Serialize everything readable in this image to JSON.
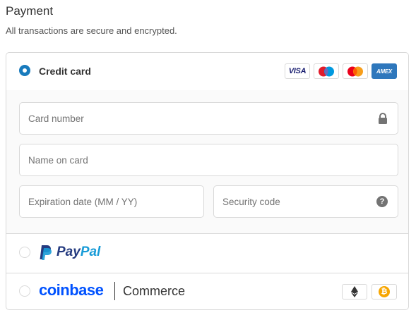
{
  "header": {
    "title": "Payment",
    "subtitle": "All transactions are secure and encrypted."
  },
  "credit_card": {
    "label": "Credit card",
    "selected": true,
    "brands": [
      "visa-icon",
      "maestro-icon",
      "mastercard-icon",
      "amex-icon"
    ],
    "brand_texts": {
      "visa": "VISA",
      "amex": "AMEX"
    }
  },
  "form": {
    "card_number_placeholder": "Card number",
    "name_placeholder": "Name on card",
    "expiry_placeholder": "Expiration date (MM / YY)",
    "security_placeholder": "Security code",
    "help_glyph": "?"
  },
  "paypal": {
    "label_pay": "Pay",
    "label_pal": "Pal",
    "selected": false
  },
  "coinbase": {
    "label": "coinbase",
    "commerce": "Commerce",
    "selected": false,
    "crypto_icons": [
      "ethereum-icon",
      "bitcoin-icon"
    ],
    "bitcoin_glyph": "₿"
  },
  "colors": {
    "accent": "#197bbd",
    "border": "#d9d9d9",
    "paypal_dark": "#253b80",
    "paypal_light": "#179bd7",
    "coinbase_blue": "#0052ff"
  }
}
